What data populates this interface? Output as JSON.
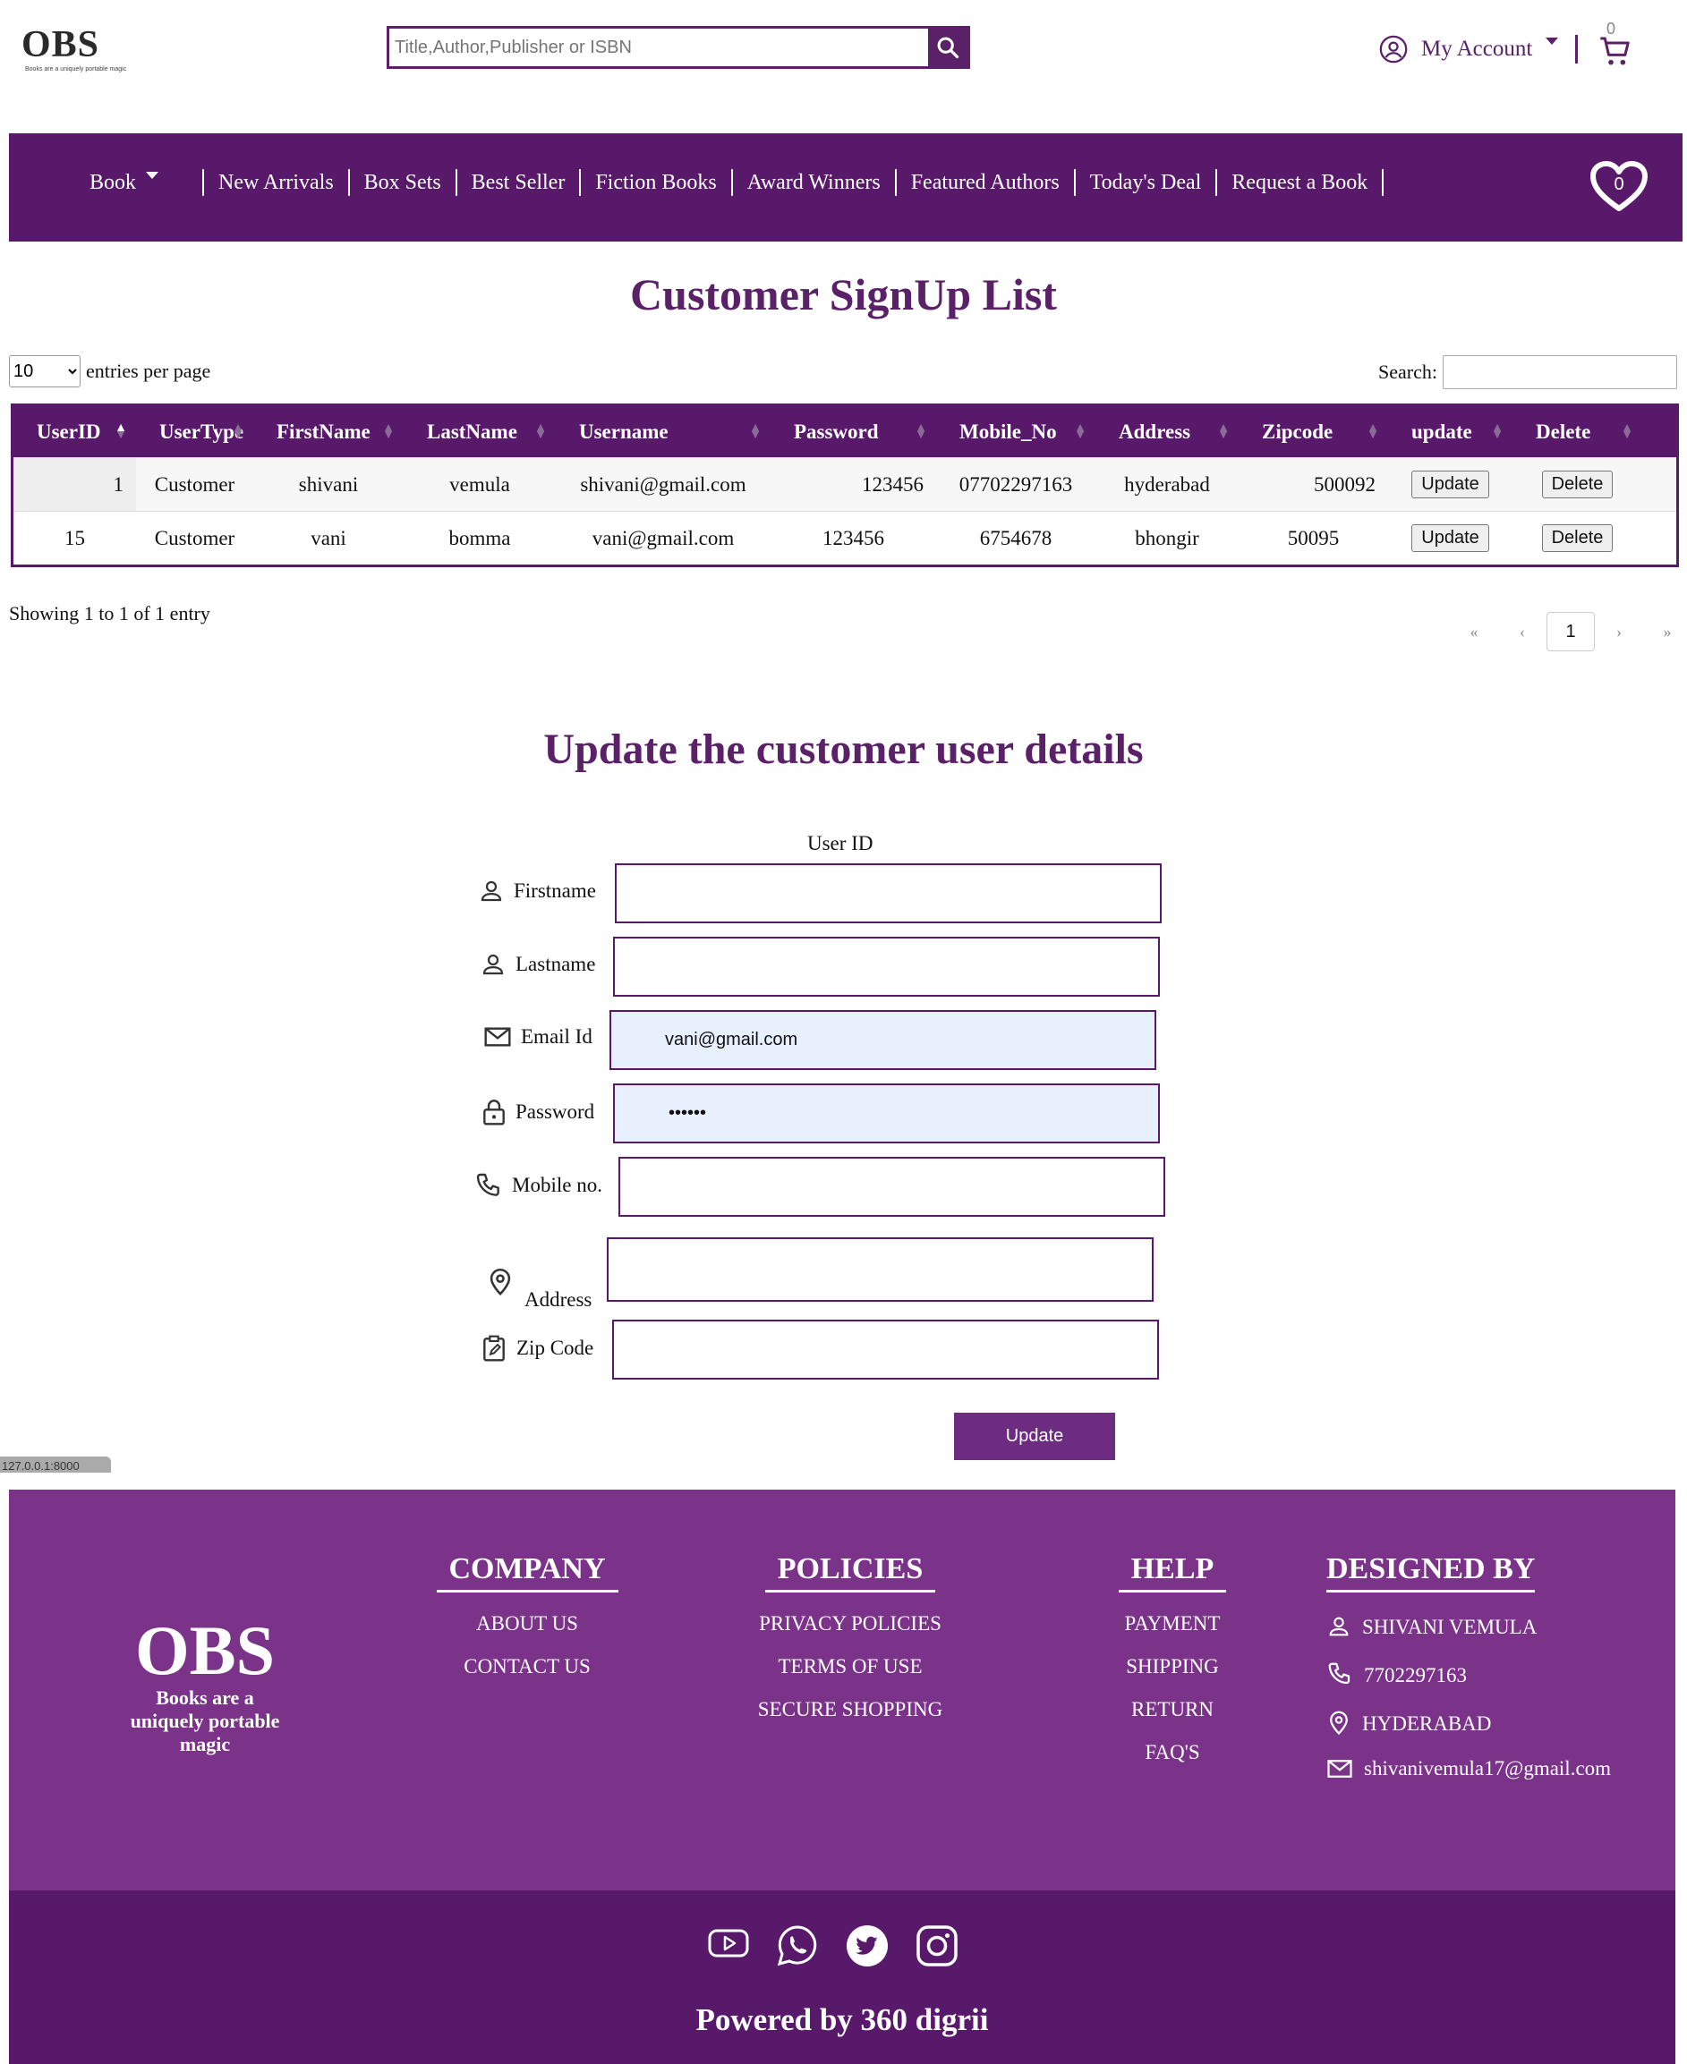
{
  "header": {
    "logo_text": "OBS",
    "logo_tagline": "Books are a uniquely portable magic",
    "search_placeholder": "Title,Author,Publisher or ISBN",
    "account_label": "My Account",
    "cart_count": "0"
  },
  "nav": {
    "items": [
      "Book",
      "New Arrivals",
      "Box Sets",
      "Best Seller",
      "Fiction Books",
      "Award Winners",
      "Featured Authors",
      "Today's Deal",
      "Request a Book"
    ],
    "wishlist_count": "0"
  },
  "list": {
    "title": "Customer SignUp List",
    "entries_value": "10",
    "entries_label": "entries per page",
    "search_label": "Search:",
    "columns": [
      "UserID",
      "UserType",
      "FirstName",
      "LastName",
      "Username",
      "Password",
      "Mobile_No",
      "Address",
      "Zipcode",
      "update",
      "Delete"
    ],
    "rows": [
      {
        "userid": "1",
        "usertype": "Customer",
        "firstname": "shivani",
        "lastname": "vemula",
        "username": "shivani@gmail.com",
        "password": "123456",
        "mobile": "07702297163",
        "address": "hyderabad",
        "zipcode": "500092",
        "update_label": "Update",
        "delete_label": "Delete"
      },
      {
        "userid": "15",
        "usertype": "Customer",
        "firstname": "vani",
        "lastname": "bomma",
        "username": "vani@gmail.com",
        "password": "123456",
        "mobile": "6754678",
        "address": "bhongir",
        "zipcode": "50095",
        "update_label": "Update",
        "delete_label": "Delete"
      }
    ],
    "showing_text": "Showing 1 to 1 of 1 entry",
    "pager": {
      "first": "«",
      "prev": "‹",
      "current": "1",
      "next": "›",
      "last": "»"
    }
  },
  "form": {
    "title": "Update the customer user details",
    "userid_label": "User ID",
    "firstname_label": "Firstname",
    "lastname_label": "Lastname",
    "email_label": "Email Id",
    "email_value": "vani@gmail.com",
    "password_label": "Password",
    "password_value": "••••••",
    "mobile_label": "Mobile no.",
    "address_label": "Address",
    "zip_label": "Zip Code",
    "submit_label": "Update"
  },
  "status_url": "127.0.0.1:8000",
  "footer": {
    "logo_text": "OBS",
    "tagline": "Books are a uniquely portable magic",
    "company": {
      "title": "COMPANY",
      "links": [
        "ABOUT US",
        "CONTACT US"
      ]
    },
    "policies": {
      "title": "POLICIES",
      "links": [
        "PRIVACY POLICIES",
        "TERMS OF USE",
        "SECURE SHOPPING"
      ]
    },
    "help": {
      "title": "HELP",
      "links": [
        "PAYMENT",
        "SHIPPING",
        "RETURN",
        "FAQ'S"
      ]
    },
    "designed": {
      "title": "DESIGNED BY",
      "name": "SHIVANI VEMULA",
      "phone": "7702297163",
      "city": "HYDERABAD",
      "email": "shivanivemula17@gmail.com"
    },
    "social_icons": [
      "youtube-icon",
      "whatsapp-icon",
      "twitter-icon",
      "instagram-icon"
    ],
    "powered": "Powered by 360 digrii"
  },
  "colors": {
    "brand": "#58196a",
    "footer": "#7a3389",
    "autofill": "#e8f0fe"
  }
}
